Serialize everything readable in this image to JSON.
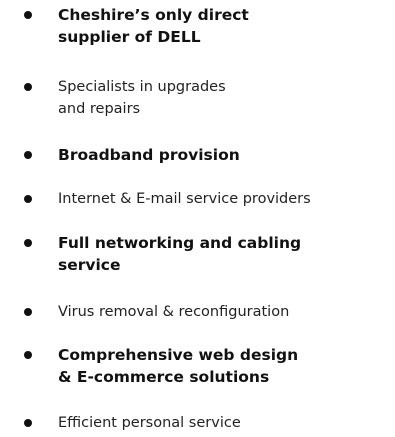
{
  "items": [
    {
      "style": "bold",
      "lines": [
        "Cheshire’s only direct",
        "supplier of DELL"
      ]
    },
    {
      "style": "normal",
      "lines": [
        "Specialists in upgrades",
        "and repairs"
      ]
    },
    {
      "style": "bold",
      "lines": [
        "Broadband provision"
      ]
    },
    {
      "style": "normal",
      "lines": [
        "Internet & E-mail service providers"
      ]
    },
    {
      "style": "bold",
      "lines": [
        "Full networking and cabling",
        "service"
      ]
    },
    {
      "style": "normal",
      "lines": [
        "Virus removal & reconfiguration"
      ]
    },
    {
      "style": "bold",
      "lines": [
        "Comprehensive web design",
        "& E-commerce solutions"
      ]
    },
    {
      "style": "normal",
      "lines": [
        "Efficient personal service"
      ]
    }
  ]
}
